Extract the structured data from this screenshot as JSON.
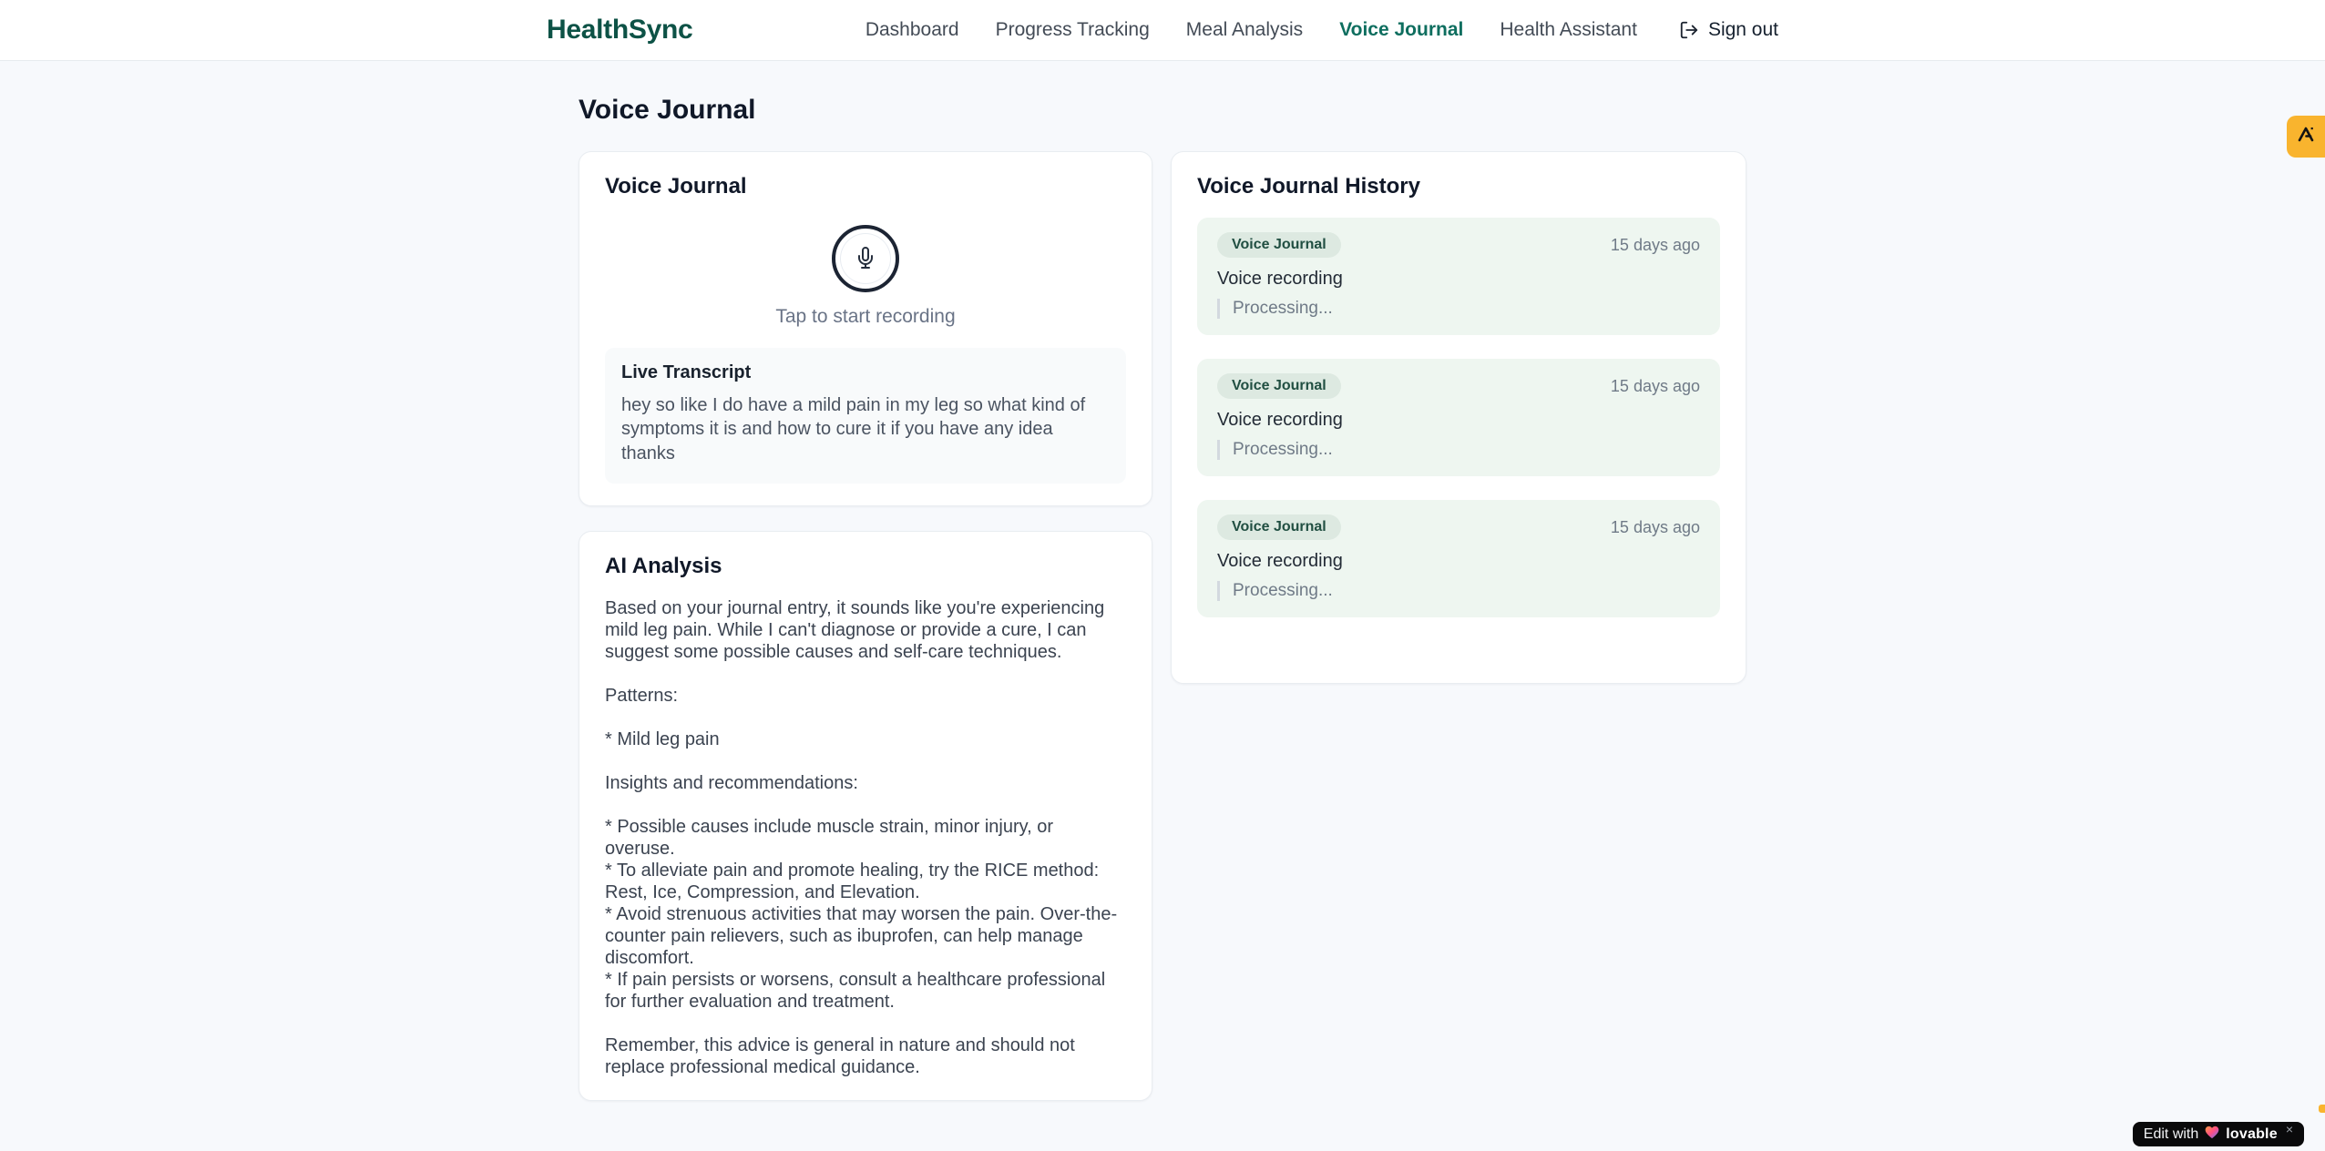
{
  "brand": {
    "name": "HealthSync"
  },
  "nav": {
    "items": [
      {
        "label": "Dashboard",
        "active": false
      },
      {
        "label": "Progress Tracking",
        "active": false
      },
      {
        "label": "Meal Analysis",
        "active": false
      },
      {
        "label": "Voice Journal",
        "active": true
      },
      {
        "label": "Health Assistant",
        "active": false
      }
    ],
    "sign_out_label": "Sign out"
  },
  "page": {
    "title": "Voice Journal"
  },
  "recorder_card": {
    "title": "Voice Journal",
    "tap_hint": "Tap to start recording",
    "transcript": {
      "title": "Live Transcript",
      "text": "hey so like I do have a mild pain in my leg so what kind of symptoms it is and how to cure it if you have any idea thanks"
    }
  },
  "analysis_card": {
    "title": "AI Analysis",
    "body": "Based on your journal entry, it sounds like you're experiencing mild leg pain. While I can't diagnose or provide a cure, I can suggest some possible causes and self-care techniques.\n\nPatterns:\n\n* Mild leg pain\n\nInsights and recommendations:\n\n* Possible causes include muscle strain, minor injury, or overuse.\n* To alleviate pain and promote healing, try the RICE method: Rest, Ice, Compression, and Elevation.\n* Avoid strenuous activities that may worsen the pain. Over-the-counter pain relievers, such as ibuprofen, can help manage discomfort.\n* If pain persists or worsens, consult a healthcare professional for further evaluation and treatment.\n\nRemember, this advice is general in nature and should not replace professional medical guidance."
  },
  "history_card": {
    "title": "Voice Journal History",
    "entries": [
      {
        "badge": "Voice Journal",
        "time": "15 days ago",
        "summary": "Voice recording",
        "status": "Processing..."
      },
      {
        "badge": "Voice Journal",
        "time": "15 days ago",
        "summary": "Voice recording",
        "status": "Processing..."
      },
      {
        "badge": "Voice Journal",
        "time": "15 days ago",
        "summary": "Voice recording",
        "status": "Processing..."
      }
    ]
  },
  "edit_badge": {
    "prefix": "Edit with",
    "brand": "lovable",
    "close": "×"
  },
  "colors": {
    "brand_green": "#0d5246",
    "active_nav_teal": "#0e6e5f",
    "history_entry_bg": "#eef6f0",
    "badge_bg": "#dde9e1",
    "badge_text": "#214f42",
    "tab_orange": "#f9b42e",
    "page_bg": "#f7f9fc"
  }
}
